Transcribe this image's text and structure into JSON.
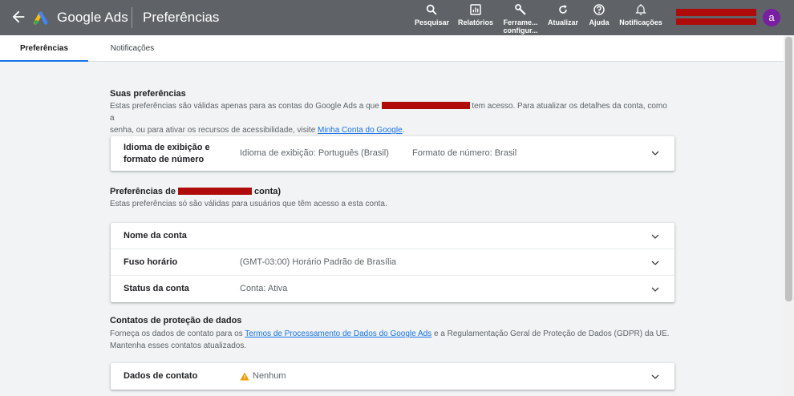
{
  "header": {
    "brand": "Google Ads",
    "page_title": "Preferências",
    "tools": [
      {
        "label": "Pesquisar",
        "label2": "",
        "icon": "search-icon"
      },
      {
        "label": "Relatórios",
        "label2": "",
        "icon": "reports-icon"
      },
      {
        "label": "Ferrame...",
        "label2": "configur...",
        "icon": "wrench-icon"
      },
      {
        "label": "Atualizar",
        "label2": "",
        "icon": "refresh-icon"
      },
      {
        "label": "Ajuda",
        "label2": "",
        "icon": "help-icon"
      },
      {
        "label": "Notificações",
        "label2": "",
        "icon": "bell-icon"
      }
    ],
    "avatar_letter": "a"
  },
  "tabs": [
    {
      "label": "Preferências",
      "active": true
    },
    {
      "label": "Notificações",
      "active": false
    }
  ],
  "section_prefs": {
    "title": "Suas preferências",
    "desc_part1": "Estas preferências são válidas apenas para as contas do Google Ads a que ",
    "desc_part2": " tem acesso. Para atualizar os detalhes da conta, como a",
    "desc_line2": "senha, ou para ativar os recursos de acessibilidade, visite ",
    "desc_link": "Minha Conta do Google",
    "desc_end": ".",
    "row": {
      "label_line1": "Idioma de exibição e",
      "label_line2": "formato de número",
      "value1": "Idioma de exibição: Português (Brasil)",
      "value2": "Formato de número: Brasil"
    }
  },
  "section_account": {
    "title_prefix": "Preferências de ",
    "title_suffix": " conta)",
    "desc": "Estas preferências só são válidas para usuários que têm acesso a esta conta.",
    "rows": [
      {
        "label": "Nome da conta",
        "value": ""
      },
      {
        "label": "Fuso horário",
        "value": "(GMT-03:00) Horário Padrão de Brasília"
      },
      {
        "label": "Status da conta",
        "value": "Conta: Ativa"
      }
    ]
  },
  "section_data": {
    "title": "Contatos de proteção de dados",
    "desc_part1": "Forneça os dados de contato para os ",
    "desc_link": "Termos de Processamento de Dados do Google Ads",
    "desc_part2": " e a Regulamentação Geral de Proteção de Dados (GDPR) da UE.",
    "desc_line2": "Mantenha esses contatos atualizados.",
    "row": {
      "label": "Dados de contato",
      "value": "Nenhum"
    }
  },
  "colors": {
    "topbar": "#5f6368",
    "accent": "#1a73e8",
    "warning": "#f29900",
    "avatar": "#7b1fa2"
  }
}
